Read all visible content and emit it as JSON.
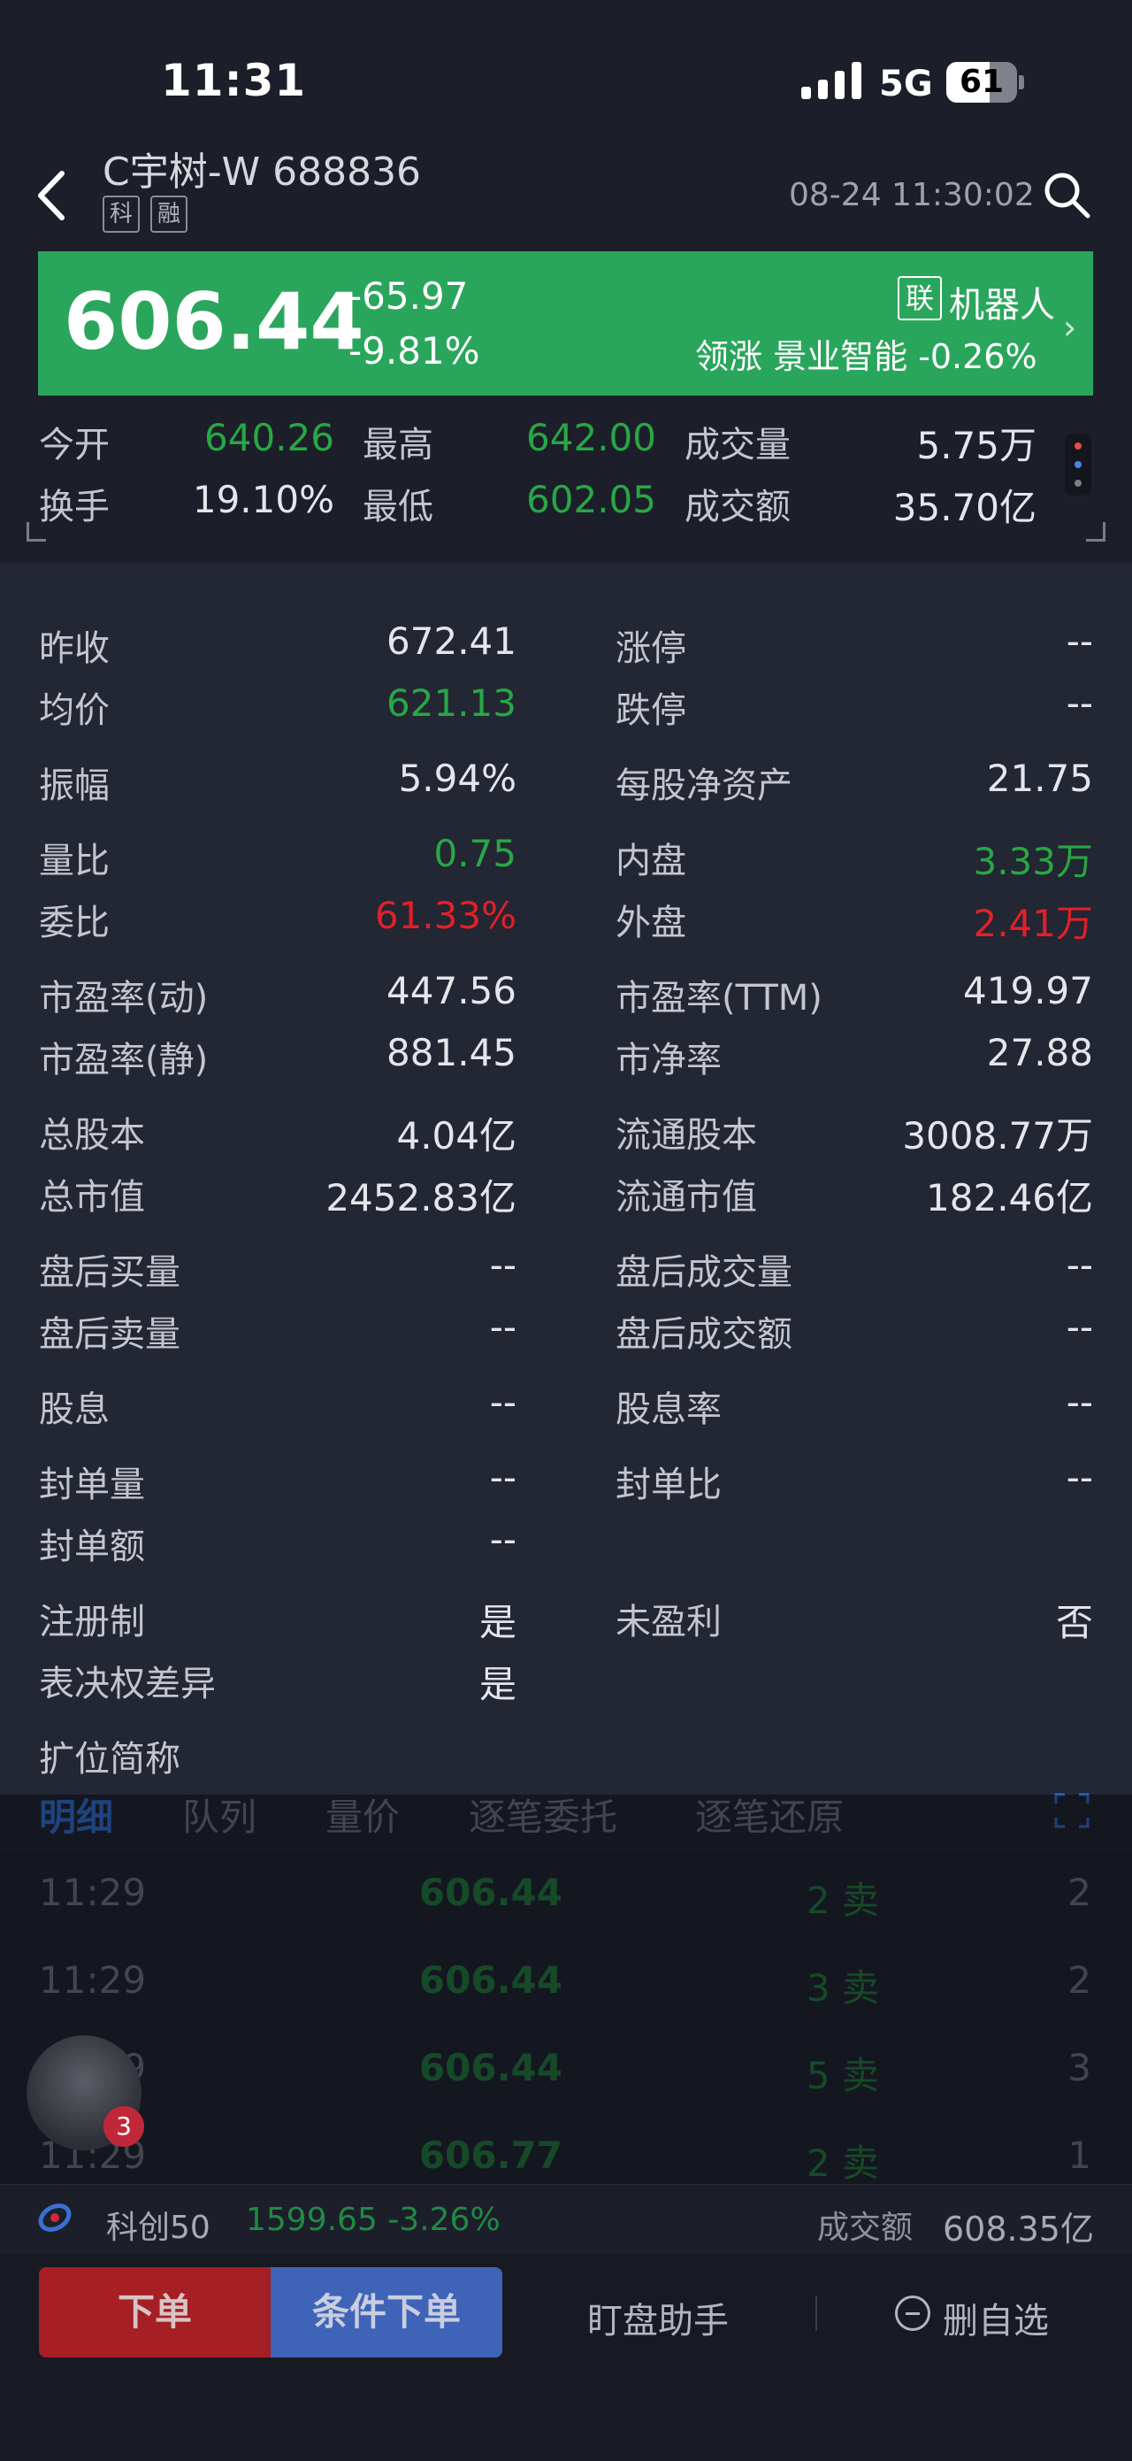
{
  "status_bar": {
    "time": "11:31",
    "network": "5G",
    "battery": "61",
    "battery_level": 0.61
  },
  "header": {
    "stock_name": "C宇树-W 688836",
    "tags": [
      "科",
      "融"
    ],
    "datetime": "08-24 11:30:02",
    "icons": [
      "back-arrow-icon",
      "search-icon"
    ]
  },
  "banner": {
    "price": "606.44",
    "change": "-65.97",
    "change_pct": "-9.81%",
    "concept_tag": "联",
    "concept_name": "机器人",
    "leader_line": "领涨 景业智能 -0.26%",
    "color": "#2aa65c"
  },
  "summary": [
    {
      "label": "今开",
      "value": "640.26",
      "color": "green"
    },
    {
      "label": "最高",
      "value": "642.00",
      "color": "green"
    },
    {
      "label": "成交量",
      "value": "5.75万",
      "color": "white"
    },
    {
      "label": "换手",
      "value": "19.10%",
      "color": "white"
    },
    {
      "label": "最低",
      "value": "602.05",
      "color": "green"
    },
    {
      "label": "成交额",
      "value": "35.70亿",
      "color": "white"
    }
  ],
  "details": {
    "left": [
      {
        "label": "昨收",
        "value": "672.41",
        "color": "white"
      },
      {
        "label": "均价",
        "value": "621.13",
        "color": "green"
      },
      {
        "label": "振幅",
        "value": "5.94%",
        "color": "white"
      },
      {
        "label": "量比",
        "value": "0.75",
        "color": "green"
      },
      {
        "label": "委比",
        "value": "61.33%",
        "color": "red"
      },
      {
        "label": "市盈率(动)",
        "value": "447.56",
        "color": "white"
      },
      {
        "label": "市盈率(静)",
        "value": "881.45",
        "color": "white"
      },
      {
        "label": "总股本",
        "value": "4.04亿",
        "color": "white"
      },
      {
        "label": "总市值",
        "value": "2452.83亿",
        "color": "white"
      },
      {
        "label": "盘后买量",
        "value": "--",
        "color": "white"
      },
      {
        "label": "盘后卖量",
        "value": "--",
        "color": "white"
      },
      {
        "label": "股息",
        "value": "--",
        "color": "white"
      },
      {
        "label": "封单量",
        "value": "--",
        "color": "white"
      },
      {
        "label": "封单额",
        "value": "--",
        "color": "white"
      },
      {
        "label": "注册制",
        "value": "是",
        "color": "white"
      },
      {
        "label": "表决权差异",
        "value": "是",
        "color": "white"
      },
      {
        "label": "扩位简称",
        "value": "",
        "color": "white"
      }
    ],
    "right": [
      {
        "label": "涨停",
        "value": "--",
        "color": "white"
      },
      {
        "label": "跌停",
        "value": "--",
        "color": "white"
      },
      {
        "label": "每股净资产",
        "value": "21.75",
        "color": "white"
      },
      {
        "label": "内盘",
        "value": "3.33万",
        "color": "green"
      },
      {
        "label": "外盘",
        "value": "2.41万",
        "color": "red"
      },
      {
        "label": "市盈率(TTM)",
        "value": "419.97",
        "color": "white"
      },
      {
        "label": "市净率",
        "value": "27.88",
        "color": "white"
      },
      {
        "label": "流通股本",
        "value": "3008.77万",
        "color": "white"
      },
      {
        "label": "流通市值",
        "value": "182.46亿",
        "color": "white"
      },
      {
        "label": "盘后成交量",
        "value": "--",
        "color": "white"
      },
      {
        "label": "盘后成交额",
        "value": "--",
        "color": "white"
      },
      {
        "label": "股息率",
        "value": "--",
        "color": "white"
      },
      {
        "label": "封单比",
        "value": "--",
        "color": "white"
      },
      {
        "label": "未盈利",
        "value": "否",
        "color": "white"
      }
    ]
  },
  "tabs": [
    "明细",
    "队列",
    "量价",
    "逐笔委托",
    "逐笔还原"
  ],
  "trades": [
    {
      "time": "11:29",
      "price": "606.44",
      "side": "2 卖",
      "count": "2"
    },
    {
      "time": "11:29",
      "price": "606.44",
      "side": "3 卖",
      "count": "2"
    },
    {
      "time": "11:29",
      "price": "606.44",
      "side": "5 卖",
      "count": "3"
    },
    {
      "time": "11:29",
      "price": "606.77",
      "side": "2 卖",
      "count": "1"
    }
  ],
  "assistant_badge": "3",
  "index_bar": {
    "name": "科创50",
    "value": "1599.65 -3.26%",
    "amount_label": "成交额",
    "amount": "608.35亿"
  },
  "toolbar": {
    "order": "下单",
    "conditional": "条件下单",
    "helper": "盯盘助手",
    "remove": "删自选"
  }
}
